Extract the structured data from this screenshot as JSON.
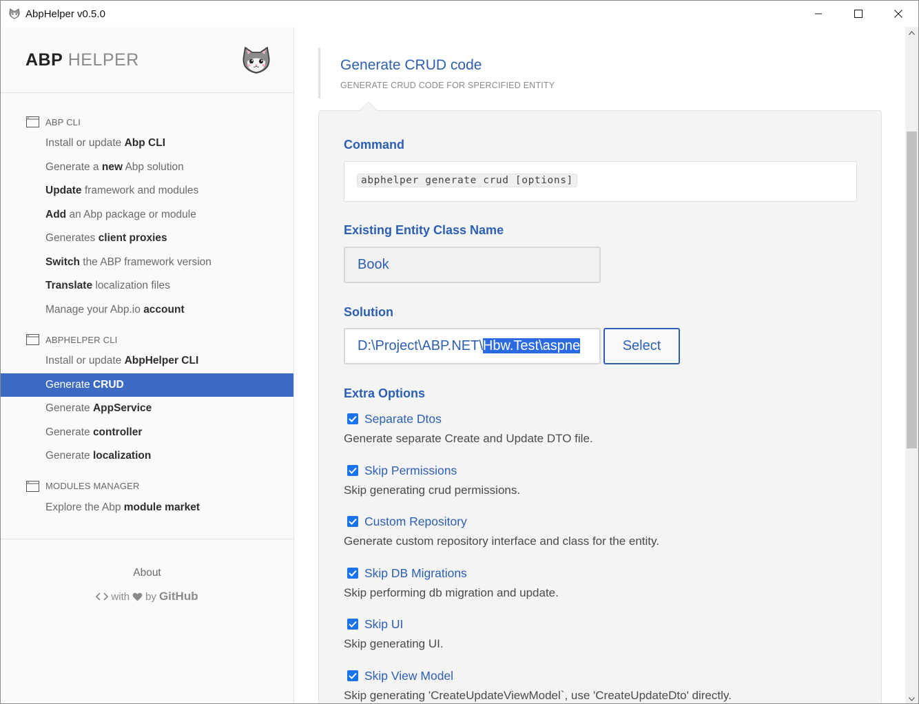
{
  "window": {
    "title": "AbpHelper v0.5.0",
    "icon": "cat-icon"
  },
  "brand": {
    "abp": "ABP",
    "helper": "HELPER"
  },
  "sidebar": {
    "sections": [
      {
        "title": "ABP CLI",
        "items": [
          {
            "pre": "Install or update ",
            "bold": "Abp CLI",
            "post": ""
          },
          {
            "pre": "Generate a ",
            "bold": "new",
            "post": " Abp solution"
          },
          {
            "pre": "",
            "bold": "Update",
            "post": " framework and modules"
          },
          {
            "pre": "",
            "bold": "Add",
            "post": " an Abp package or module"
          },
          {
            "pre": "Generates ",
            "bold": "client proxies",
            "post": ""
          },
          {
            "pre": "",
            "bold": "Switch",
            "post": " the ABP framework version"
          },
          {
            "pre": "",
            "bold": "Translate",
            "post": " localization files"
          },
          {
            "pre": "Manage your Abp.io ",
            "bold": "account",
            "post": ""
          }
        ]
      },
      {
        "title": "ABPHELPER CLI",
        "items": [
          {
            "pre": "Install or update ",
            "bold": "AbpHelper CLI",
            "post": ""
          },
          {
            "pre": "Generate ",
            "bold": "CRUD",
            "post": ""
          },
          {
            "pre": "Generate ",
            "bold": "AppService",
            "post": ""
          },
          {
            "pre": "Generate ",
            "bold": "controller",
            "post": ""
          },
          {
            "pre": "Generate ",
            "bold": "localization",
            "post": ""
          }
        ]
      },
      {
        "title": "MODULES MANAGER",
        "items": [
          {
            "pre": "Explore the Abp ",
            "bold": "module market",
            "post": ""
          }
        ]
      }
    ],
    "footer": {
      "about": "About",
      "made_with_pre": "with",
      "made_with_by": "by",
      "github": "GitHub"
    }
  },
  "page": {
    "title": "Generate CRUD code",
    "subtitle": "GENERATE CRUD CODE FOR SPERCIFIED ENTITY"
  },
  "form": {
    "command_label": "Command",
    "command": "abphelper generate crud [options]",
    "entity_label": "Existing Entity Class Name",
    "entity_value": "Book",
    "solution_label": "Solution",
    "solution_value_plain": "D:\\Project\\ABP.NET\\",
    "solution_value_selected": "Hbw.Test\\aspne",
    "select_button": "Select",
    "extra_label": "Extra Options",
    "options": [
      {
        "title": "Separate Dtos",
        "desc": "Generate separate Create and Update DTO file.",
        "checked": true
      },
      {
        "title": "Skip Permissions",
        "desc": "Skip generating crud permissions.",
        "checked": true
      },
      {
        "title": "Custom Repository",
        "desc": "Generate custom repository interface and class for the entity.",
        "checked": true
      },
      {
        "title": "Skip DB Migrations",
        "desc": "Skip performing db migration and update.",
        "checked": true
      },
      {
        "title": "Skip UI",
        "desc": "Skip generating UI.",
        "checked": true
      },
      {
        "title": "Skip View Model",
        "desc": "Skip generating 'CreateUpdateViewModel`, use 'CreateUpdateDto' directly.",
        "checked": true
      }
    ]
  },
  "colors": {
    "accent": "#2c5fb3",
    "active_menu": "#3d6bc4",
    "checkbox": "#1a73e8"
  }
}
